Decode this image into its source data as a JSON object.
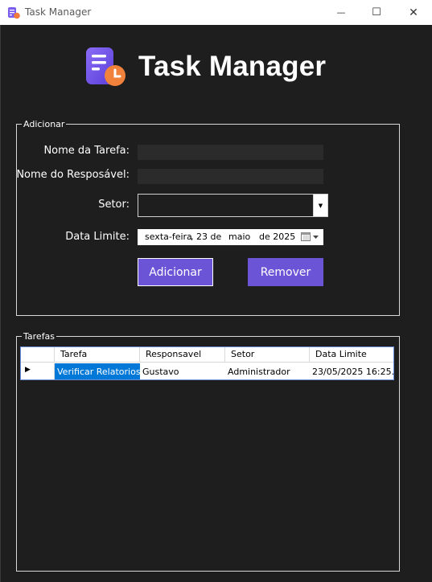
{
  "window": {
    "title": "Task Manager",
    "controls": {
      "minimize": "—",
      "maximize": "☐",
      "close": "✕"
    }
  },
  "header": {
    "title": "Task Manager",
    "logo_icon": "task-clock-icon"
  },
  "add_group": {
    "label": "Adicionar",
    "task_name_label": "Nome da Tarefa:",
    "task_name_value": "",
    "responsible_label": "Nome do Resposável:",
    "responsible_value": "",
    "sector_label": "Setor:",
    "sector_value": "",
    "date_label": "Data Limite:",
    "date": {
      "weekday": "sexta-feira",
      "day": ", 23 de",
      "month": "maio",
      "year": "de 2025"
    },
    "add_button": "Adicionar",
    "remove_button": "Remover"
  },
  "tasks_group": {
    "label": "Tarefas",
    "columns": [
      "Tarefa",
      "Responsavel",
      "Setor",
      "Data Limite"
    ],
    "rows": [
      {
        "indicator": "▶",
        "tarefa": "Verificar Relatorios",
        "responsavel": "Gustavo",
        "setor": "Administrador",
        "data_limite": "23/05/2025 16:25..."
      }
    ]
  },
  "colors": {
    "background": "#1e1e1e",
    "accent": "#6b55d6",
    "input": "#2b2b2b",
    "selected_cell": "#0078d7"
  }
}
